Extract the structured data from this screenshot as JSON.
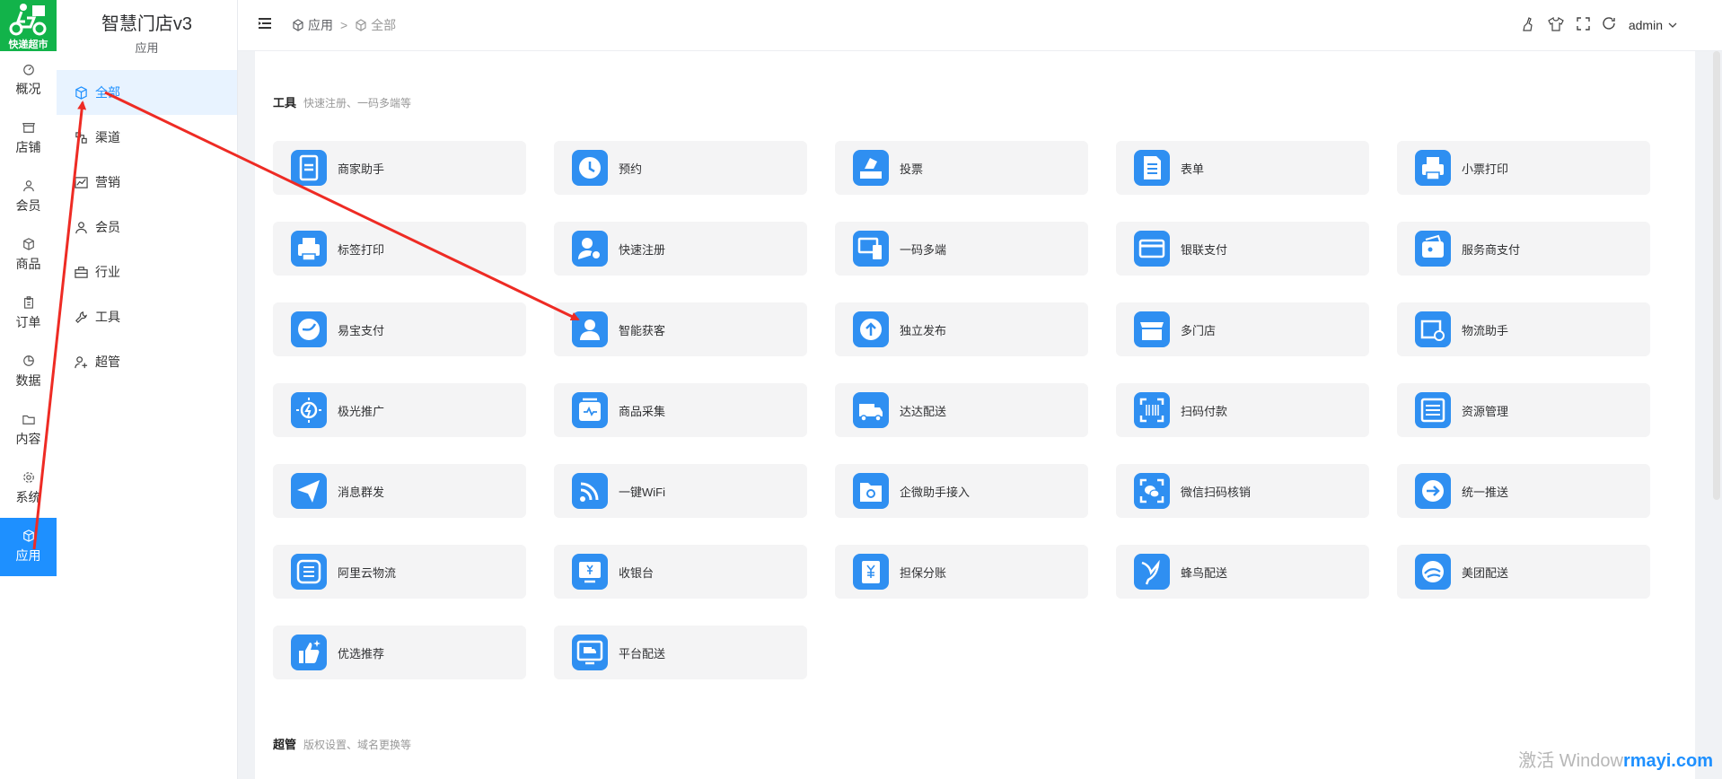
{
  "logo": {
    "text": "快递超市"
  },
  "rail": [
    {
      "label": "概况",
      "icon": "dashboard-icon"
    },
    {
      "label": "店铺",
      "icon": "shop-icon"
    },
    {
      "label": "会员",
      "icon": "user-icon"
    },
    {
      "label": "商品",
      "icon": "box-icon"
    },
    {
      "label": "订单",
      "icon": "clipboard-icon"
    },
    {
      "label": "数据",
      "icon": "pie-icon"
    },
    {
      "label": "内容",
      "icon": "folder-icon"
    },
    {
      "label": "系统",
      "icon": "gear-icon"
    },
    {
      "label": "应用",
      "icon": "cube-icon"
    }
  ],
  "brand": {
    "title": "智慧门店v3",
    "subtitle": "应用"
  },
  "submenu": [
    {
      "label": "全部",
      "icon": "cube-icon"
    },
    {
      "label": "渠道",
      "icon": "channel-icon"
    },
    {
      "label": "营销",
      "icon": "chart-icon"
    },
    {
      "label": "会员",
      "icon": "user-icon"
    },
    {
      "label": "行业",
      "icon": "briefcase-icon"
    },
    {
      "label": "工具",
      "icon": "wrench-icon"
    },
    {
      "label": "超管",
      "icon": "admin-icon"
    }
  ],
  "breadcrumb": {
    "first": "应用",
    "sep": ">",
    "current": "全部"
  },
  "header": {
    "user": "admin"
  },
  "tools_section": {
    "title": "工具",
    "desc": "快速注册、一码多端等"
  },
  "apps": [
    "商家助手",
    "预约",
    "投票",
    "表单",
    "小票打印",
    "标签打印",
    "快速注册",
    "一码多端",
    "银联支付",
    "服务商支付",
    "易宝支付",
    "智能获客",
    "独立发布",
    "多门店",
    "物流助手",
    "极光推广",
    "商品采集",
    "达达配送",
    "扫码付款",
    "资源管理",
    "消息群发",
    "一键WiFi",
    "企微助手接入",
    "微信扫码核销",
    "统一推送",
    "阿里云物流",
    "收银台",
    "担保分账",
    "蜂鸟配送",
    "美团配送",
    "优选推荐",
    "平台配送"
  ],
  "admin_section": {
    "title": "超管",
    "desc": "版权设置、域名更换等"
  },
  "watermark": {
    "prefix": "激活 Window",
    "brand": "rmayi.com"
  },
  "colors": {
    "accent": "#1e90ff",
    "icon_bg": "#2f8ff1",
    "arrow": "#ee2b24"
  }
}
